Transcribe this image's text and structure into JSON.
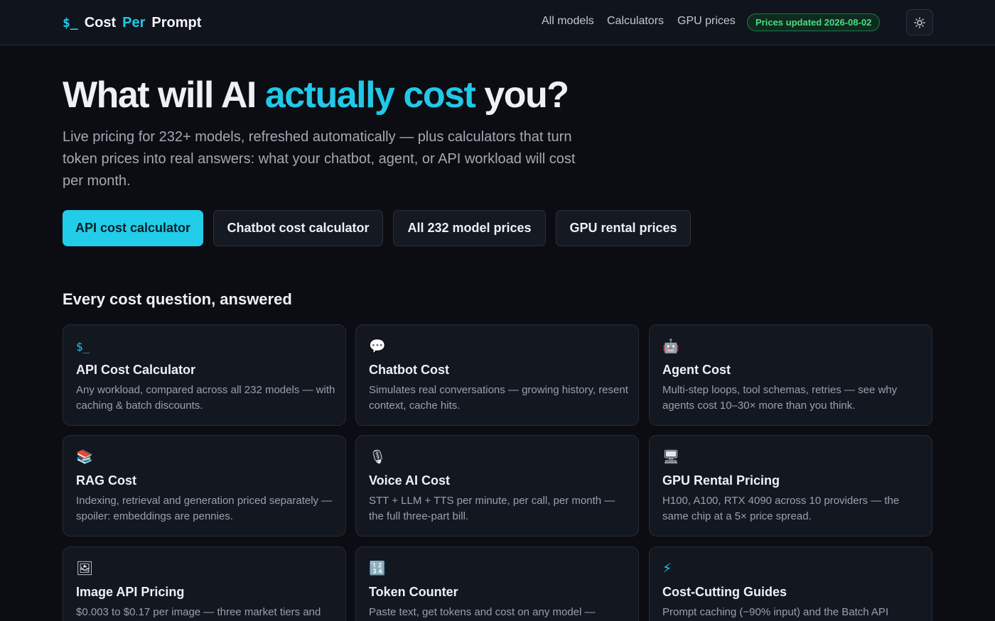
{
  "header": {
    "logo_symbol": "$_",
    "logo_word1": "Cost",
    "logo_word2": "Per",
    "logo_word3": "Prompt",
    "nav": [
      "All models",
      "Calculators",
      "GPU prices"
    ],
    "badge": "Prices updated 2026-08-02"
  },
  "hero": {
    "title_pre": "What will AI",
    "title_accent": "actually cost",
    "title_post": "you?",
    "subtitle": "Live pricing for 232+ models, refreshed automatically — plus calculators that turn token prices into real answers: what your chatbot, agent, or API workload will cost per month.",
    "ctas": [
      "API cost calculator",
      "Chatbot cost calculator",
      "All 232 model prices",
      "GPU rental prices"
    ]
  },
  "section": {
    "title": "Every cost question, answered"
  },
  "cards": [
    {
      "icon": "$_",
      "icon_name": "terminal-icon",
      "title": "API Cost Calculator",
      "desc": "Any workload, compared across all 232 models — with caching & batch discounts."
    },
    {
      "icon": "💬",
      "icon_name": "speech-bubble-icon",
      "title": "Chatbot Cost",
      "desc": "Simulates real conversations — growing history, resent context, cache hits."
    },
    {
      "icon": "🤖",
      "icon_name": "robot-icon",
      "title": "Agent Cost",
      "desc": "Multi-step loops, tool schemas, retries — see why agents cost 10–30× more than you think."
    },
    {
      "icon": "📚",
      "icon_name": "books-icon",
      "title": "RAG Cost",
      "desc": "Indexing, retrieval and generation priced separately — spoiler: embeddings are pennies."
    },
    {
      "icon": "🎙",
      "icon_name": "microphone-icon",
      "title": "Voice AI Cost",
      "desc": "STT + LLM + TTS per minute, per call, per month — the full three-part bill."
    },
    {
      "icon": "🖥",
      "icon_name": "desktop-computer-icon",
      "title": "GPU Rental Pricing",
      "desc": "H100, A100, RTX 4090 across 10 providers — the same chip at a 5× price spread."
    },
    {
      "icon": "🖼",
      "icon_name": "framed-picture-icon",
      "title": "Image API Pricing",
      "desc": "$0.003 to $0.17 per image — three market tiers and"
    },
    {
      "icon": "🔢",
      "icon_name": "numbers-icon",
      "title": "Token Counter",
      "desc": "Paste text, get tokens and cost on any model —"
    },
    {
      "icon": "⚡",
      "icon_name": "lightning-icon",
      "title": "Cost-Cutting Guides",
      "desc": "Prompt caching (−90% input) and the Batch API"
    }
  ]
}
